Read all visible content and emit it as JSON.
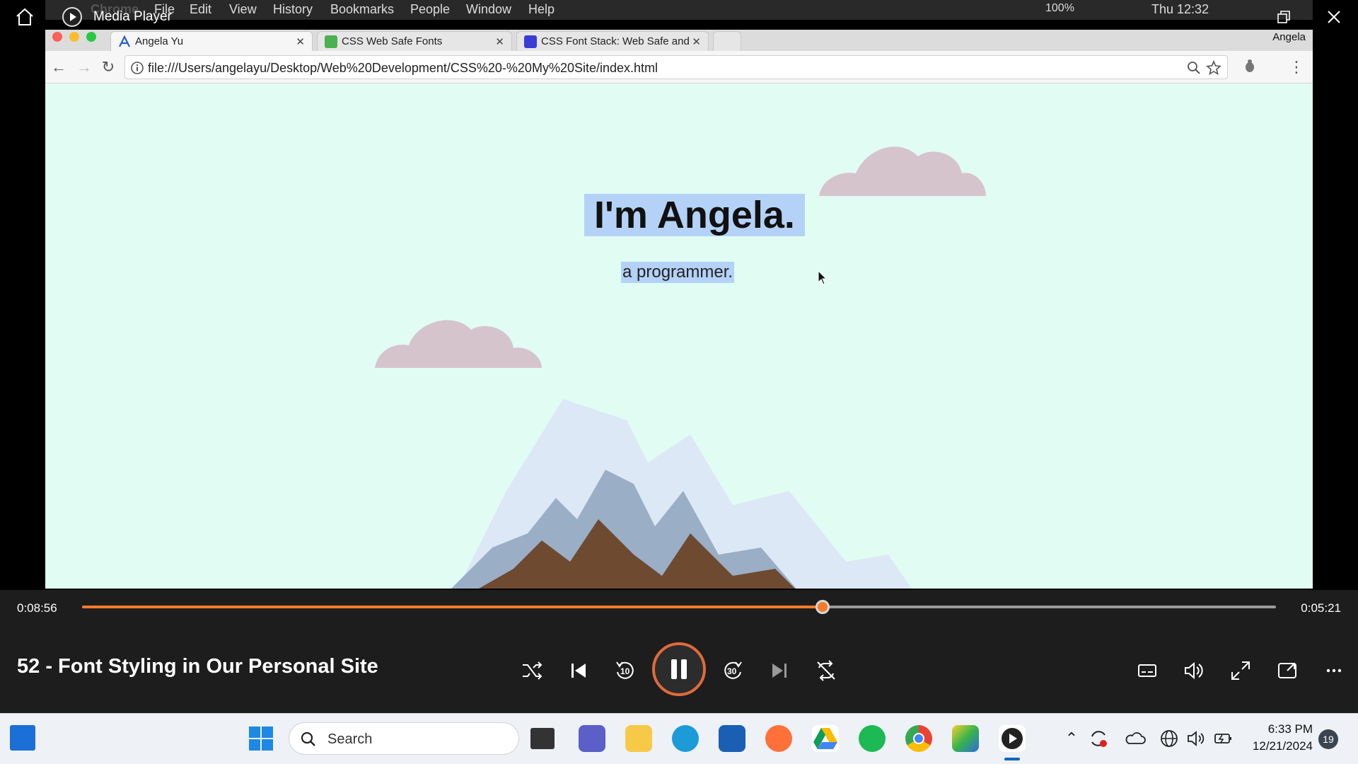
{
  "player": {
    "app_title": "Media Player",
    "time_elapsed": "0:08:56",
    "time_remaining": "0:05:21",
    "progress": 0.62,
    "episode_title": "52 - Font Styling in Our Personal Site",
    "skip_back_label": "10",
    "skip_forward_label": "30",
    "accent_color": "#f47b2a"
  },
  "mac_menubar": {
    "items": [
      "Chrome",
      "File",
      "Edit",
      "View",
      "History",
      "Bookmarks",
      "People",
      "Window",
      "Help"
    ],
    "battery": "100%",
    "clock": "Thu 12:32"
  },
  "browser": {
    "tabs": [
      {
        "label": "Angela Yu",
        "active": true
      },
      {
        "label": "CSS Web Safe Fonts",
        "active": false
      },
      {
        "label": "CSS Font Stack: Web Safe and",
        "active": false
      }
    ],
    "profile": "Angela",
    "url": "file:///Users/angelayu/Desktop/Web%20Development/CSS%20-%20My%20Site/index.html"
  },
  "page": {
    "title": "I'm Angela.",
    "subtitle": "a programmer.",
    "background": "#e1fcf3",
    "cloud_color": "#d6c4cc"
  },
  "taskbar": {
    "search_placeholder": "Search",
    "time": "6:33 PM",
    "date": "12/21/2024",
    "notification_count": "19"
  }
}
